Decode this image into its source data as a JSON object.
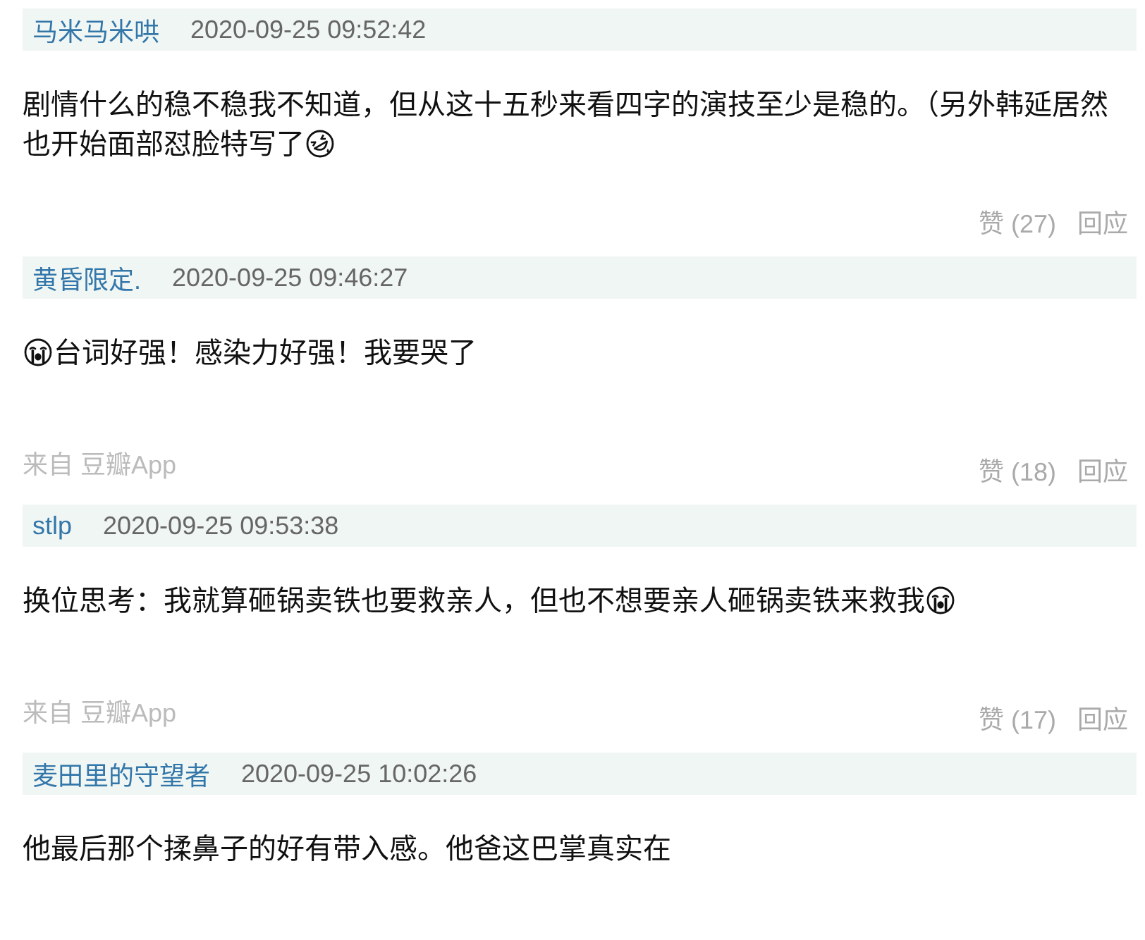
{
  "comments": [
    {
      "author": "马米马米哄",
      "time": "2020-09-25 09:52:42",
      "content": [
        [
          {
            "kind": "text",
            "text": "剧情什么的稳不稳我不知道，但从这十五秒来看四字的演技至少是稳的。（另外韩延居然"
          }
        ],
        [
          {
            "kind": "text",
            "text": "也开始面部怼脸特写了"
          },
          {
            "kind": "laughing"
          }
        ]
      ],
      "like": "赞 (27)",
      "reply": "回应"
    },
    {
      "author": "黄昏限定.",
      "time": "2020-09-25 09:46:27",
      "content": [
        [
          {
            "kind": "crying"
          },
          {
            "kind": "text",
            "text": "台词好强！感染力好强！我要哭了"
          }
        ]
      ],
      "source": "来自 豆瓣App",
      "like": "赞 (18)",
      "reply": "回应"
    },
    {
      "author": "stlp",
      "time": "2020-09-25 09:53:38",
      "content": [
        [
          {
            "kind": "text",
            "text": "换位思考：我就算砸锅卖铁也要救亲人，但也不想要亲人砸锅卖铁来救我"
          },
          {
            "kind": "crying"
          }
        ]
      ],
      "source": "来自 豆瓣App",
      "like": "赞 (17)",
      "reply": "回应"
    },
    {
      "author": "麦田里的守望者",
      "time": "2020-09-25 10:02:26",
      "content": [
        [
          {
            "kind": "text",
            "text": "他最后那个揉鼻子的好有带入感。他爸这巴掌真实在"
          }
        ]
      ]
    }
  ]
}
